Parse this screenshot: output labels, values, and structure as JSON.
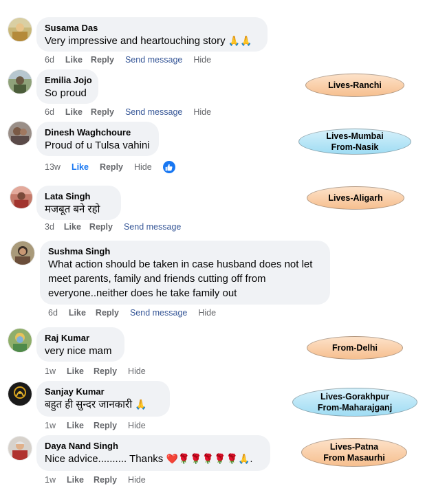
{
  "actions": {
    "like": "Like",
    "reply": "Reply",
    "send_message": "Send message",
    "hide": "Hide"
  },
  "comments": [
    {
      "author": "Susama Das",
      "text": "Very impressive and heartouching story",
      "time": "6d",
      "emojis": "🙏🙏"
    },
    {
      "author": "Emilia Jojo",
      "text": "So proud",
      "time": "6d"
    },
    {
      "author": "Dinesh Waghchoure",
      "text": "Proud of u Tulsa vahini",
      "time": "13w",
      "liked": true
    },
    {
      "author": "Lata Singh",
      "text": "मजबूत बने रहो",
      "time": "3d"
    },
    {
      "author": "Sushma Singh",
      "text": "What action should be taken in case husband does not let meet parents, family and friends cutting off from everyone..neither does he take family out",
      "time": "6d"
    },
    {
      "author": "Raj Kumar",
      "text": "very nice mam",
      "time": "1w"
    },
    {
      "author": "Sanjay Kumar",
      "text": "बहुत ही सुन्दर जानकारी",
      "time": "1w",
      "emojis": "🙏"
    },
    {
      "author": "Daya Nand Singh",
      "text": "Nice advice.......... Thanks",
      "time": "1w",
      "emojis": "❤️🌹🌹🌹🌹🌹🙏."
    }
  ],
  "tags": [
    {
      "line1": "Lives-Ranchi",
      "color": "#f6bf8f"
    },
    {
      "line1": "Lives-Mumbai",
      "line2": "From-Nasik",
      "color": "#9fdcf3"
    },
    {
      "line1": "Lives-Aligarh",
      "color": "#f6bf8f"
    },
    {
      "line1": "From-Delhi",
      "color": "#f6bf8f"
    },
    {
      "line1": "Lives-Gorakhpur",
      "line2": "From-Maharajganj",
      "color": "#9fdcf3"
    },
    {
      "line1": "Lives-Patna",
      "line2": "From Masaurhi",
      "color": "#f6bf8f"
    }
  ]
}
